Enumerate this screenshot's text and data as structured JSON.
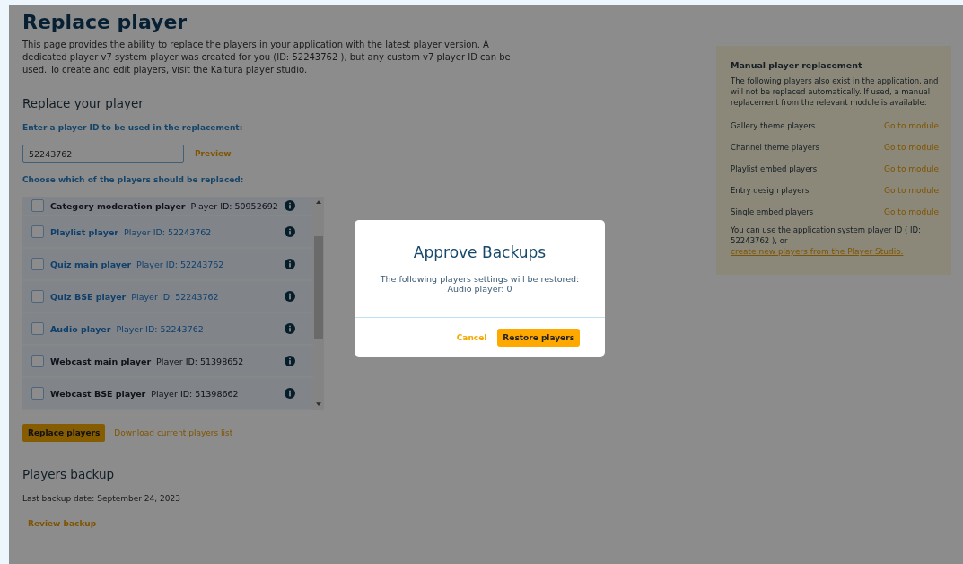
{
  "page": {
    "title": "Replace player",
    "intro": "This page provides the ability to replace the players in your application with the latest player version. A dedicated player v7 system player was created for you (ID: 52243762 ), but any custom v7 player ID can be used. To create and edit players, visit the Kaltura player studio."
  },
  "replace": {
    "heading": "Replace your player",
    "id_label": "Enter a player ID to be used in the replacement:",
    "id_value": "52243762",
    "preview": "Preview",
    "choose_label": "Choose which of the players should be replaced:",
    "players": [
      {
        "name": "Category moderation player",
        "player_id": "Player ID: 50952692",
        "checked": false,
        "disabled": false
      },
      {
        "name": "Playlist player",
        "player_id": "Player ID: 52243762",
        "checked": false,
        "disabled": true
      },
      {
        "name": "Quiz main player",
        "player_id": "Player ID: 52243762",
        "checked": false,
        "disabled": true
      },
      {
        "name": "Quiz BSE player",
        "player_id": "Player ID: 52243762",
        "checked": false,
        "disabled": true
      },
      {
        "name": "Audio player",
        "player_id": "Player ID: 52243762",
        "checked": false,
        "disabled": true
      },
      {
        "name": "Webcast main player",
        "player_id": "Player ID: 51398652",
        "checked": false,
        "disabled": false
      },
      {
        "name": "Webcast BSE player",
        "player_id": "Player ID: 51398662",
        "checked": false,
        "disabled": false
      }
    ],
    "replace_button": "Replace players",
    "download_link": "Download current players list"
  },
  "backup": {
    "heading": "Players backup",
    "last_date": "Last backup date: September 24, 2023",
    "review_link": "Review backup"
  },
  "manual": {
    "title": "Manual player replacement",
    "text": "The following players also exist in the application, and will not be replaced automatically. If used, a manual replacement from the relevant module is available:",
    "modules": [
      {
        "name": "Gallery theme players",
        "link": "Go to module"
      },
      {
        "name": "Channel theme players",
        "link": "Go to module"
      },
      {
        "name": "Playlist embed players",
        "link": "Go to module"
      },
      {
        "name": "Entry design players",
        "link": "Go to module"
      },
      {
        "name": "Single embed players",
        "link": "Go to module"
      }
    ],
    "footer_text": "You can use the application system player ID ( ID: 52243762 ), or",
    "footer_link": "create new players from the Player Studio."
  },
  "dialog": {
    "title": "Approve Backups",
    "message": "The following players settings will be restored:",
    "detail": "Audio player: 0",
    "cancel": "Cancel",
    "confirm": "Restore players"
  }
}
